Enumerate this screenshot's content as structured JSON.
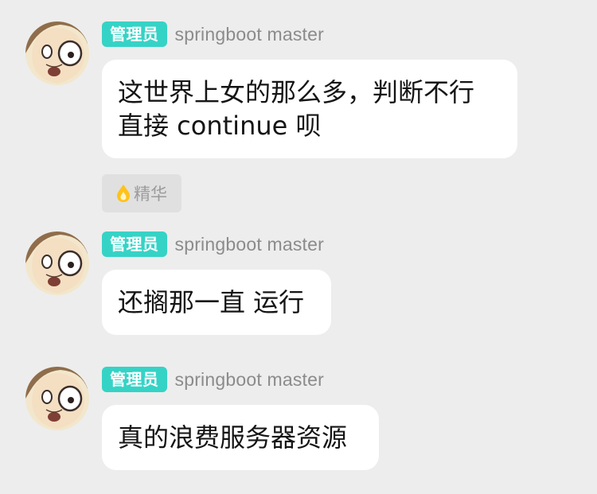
{
  "messages": [
    {
      "role_badge": "管理员",
      "username": "springboot master",
      "text_line1": "这世界上女的那么多，判断不行",
      "text_line2": "直接 continue 呗"
    },
    {
      "role_badge": "管理员",
      "username": "springboot master",
      "text": "还搁那一直 运行"
    },
    {
      "role_badge": "管理员",
      "username": "springboot master",
      "text": "真的浪费服务器资源"
    }
  ],
  "highlight_tag": {
    "icon": "flame-drop-icon",
    "label": "精华"
  },
  "colors": {
    "background": "#ededed",
    "badge": "#35d3c6",
    "bubble": "#ffffff",
    "username": "#8b8b8b",
    "highlight_tag_bg": "#e0e0e0",
    "highlight_icon": "#ffc21a"
  }
}
